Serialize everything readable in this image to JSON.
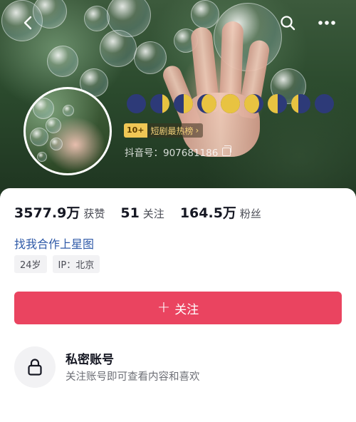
{
  "header": {
    "account_id_label": "抖音号：",
    "account_id": "907681186",
    "rank_number": "10+",
    "rank_label": "短剧最热榜",
    "rank_arrow": "›"
  },
  "moons": [
    {
      "name": "new-moon",
      "lit": "none"
    },
    {
      "name": "waxing-crescent",
      "lit": "right"
    },
    {
      "name": "first-quarter",
      "lit": "right-half"
    },
    {
      "name": "waxing-gibbous",
      "lit": "gibbous"
    },
    {
      "name": "full-moon",
      "lit": "full"
    },
    {
      "name": "waning-gibbous",
      "lit": "gibbous-left"
    },
    {
      "name": "last-quarter",
      "lit": "left-half"
    },
    {
      "name": "waning-crescent",
      "lit": "left"
    },
    {
      "name": "new-moon-2",
      "lit": "none"
    }
  ],
  "colors": {
    "moon_dark": "#2d3a78",
    "moon_light": "#e8c341",
    "follow_button": "#ea4460",
    "link": "#2f5aa8"
  },
  "stats": {
    "likes_value": "3577.9万",
    "likes_label": "获赞",
    "following_value": "51",
    "following_label": "关注",
    "followers_value": "164.5万",
    "followers_label": "粉丝"
  },
  "cooperation_link": "找我合作上星图",
  "tags": {
    "age": "24岁",
    "ip": "IP：北京"
  },
  "follow_button": {
    "icon": "+",
    "label": "关注"
  },
  "private_account": {
    "title": "私密账号",
    "subtitle": "关注账号即可查看内容和喜欢"
  },
  "icons": [
    "back-icon",
    "search-icon",
    "more-icon",
    "copy-icon",
    "lock-icon"
  ]
}
